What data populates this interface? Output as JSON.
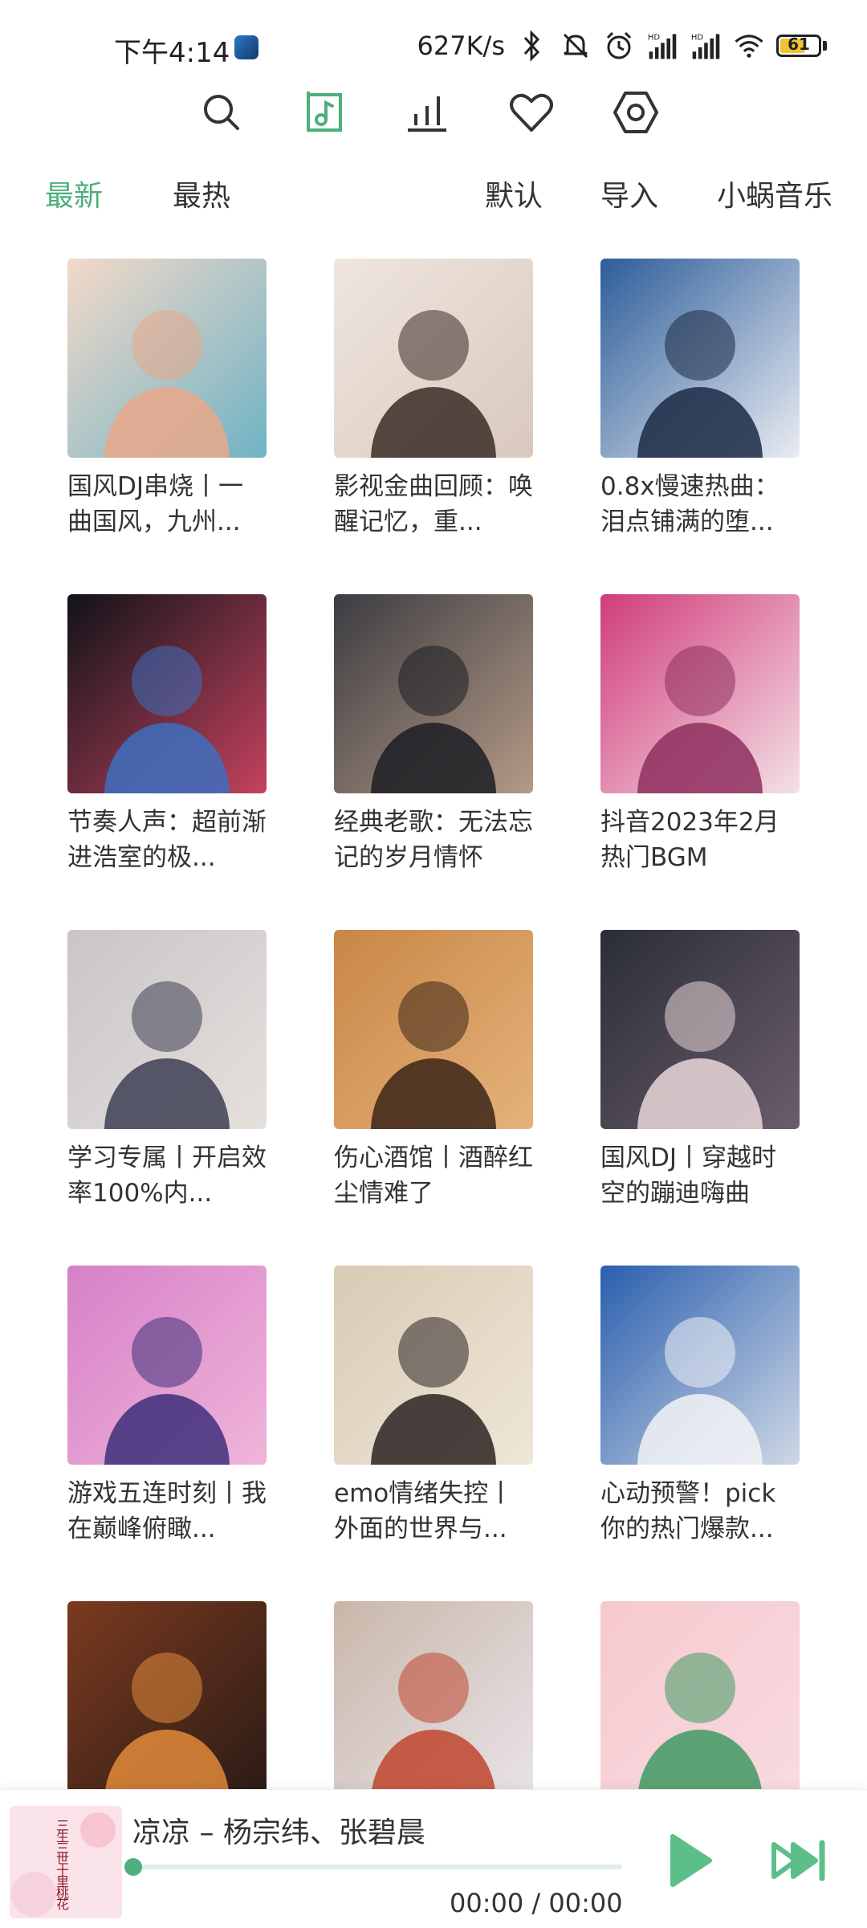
{
  "status_bar": {
    "time": "下午4:14",
    "speed": "627K/s",
    "battery": "61",
    "icons": [
      "bluetooth-icon",
      "mute-icon",
      "alarm-icon",
      "signal-hd-icon",
      "signal-hd-icon",
      "wifi-icon",
      "battery-icon"
    ]
  },
  "nav_icons": [
    "search-icon",
    "music-file-icon",
    "chart-icon",
    "heart-icon",
    "settings-hex-icon"
  ],
  "accent_color": "#4caf7d",
  "tabs": {
    "latest": "最新",
    "hottest": "最热",
    "default": "默认",
    "import": "导入",
    "source": "小蜗音乐"
  },
  "playlists": [
    {
      "title": "国风DJ串烧丨一曲国风，九州...",
      "colors": [
        "#f3d9c9",
        "#e9a889",
        "#6fb3c4"
      ]
    },
    {
      "title": "影视金曲回顾：唤醒记忆，重...",
      "colors": [
        "#efe6df",
        "#3b2b26",
        "#d9c8bd"
      ]
    },
    {
      "title": "0.8x慢速热曲：泪点铺满的堕...",
      "colors": [
        "#2d5d9a",
        "#1b2a44",
        "#e9ecf2"
      ]
    },
    {
      "title": "节奏人声：超前渐进浩室的极...",
      "colors": [
        "#101318",
        "#3d6fbf",
        "#c4425f"
      ]
    },
    {
      "title": "经典老歌：无法忘记的岁月情怀",
      "colors": [
        "#3c3c42",
        "#1c1d23",
        "#b49a86"
      ]
    },
    {
      "title": "抖音2023年2月热门BGM",
      "colors": [
        "#d03c7a",
        "#8e2f5e",
        "#f4e1e7"
      ]
    },
    {
      "title": "学习专属丨开启效率100%内...",
      "colors": [
        "#c9c5c8",
        "#3c3e52",
        "#e6e0dc"
      ]
    },
    {
      "title": "伤心酒馆丨酒醉红尘情难了",
      "colors": [
        "#c88746",
        "#3b2418",
        "#e5b27b"
      ]
    },
    {
      "title": "国风DJ丨穿越时空的蹦迪嗨曲",
      "colors": [
        "#2a2e36",
        "#e9d7d8",
        "#6b5c6c"
      ]
    },
    {
      "title": "游戏五连时刻丨我在巅峰俯瞰...",
      "colors": [
        "#d681c8",
        "#3e2f7a",
        "#f0b4d9"
      ]
    },
    {
      "title": "emo情绪失控丨外面的世界与...",
      "colors": [
        "#d9cbb4",
        "#2a2322",
        "#efe6d8"
      ]
    },
    {
      "title": "心动预警！pick你的热门爆款...",
      "colors": [
        "#2b5fae",
        "#f2f3f6",
        "#cfd8e6"
      ]
    },
    {
      "title": "",
      "colors": [
        "#7b3a1f",
        "#e28a3b",
        "#2a1b16"
      ]
    },
    {
      "title": "",
      "colors": [
        "#c9b7a8",
        "#c0452d",
        "#e9e3ea"
      ]
    },
    {
      "title": "",
      "colors": [
        "#f6c9cf",
        "#3f9a63",
        "#f8dbe0"
      ]
    }
  ],
  "player": {
    "title": "凉凉 – 杨宗纬、张碧晨",
    "time": "00:00 / 00:00",
    "progress": 0,
    "art_text": "三生三世十里桃花"
  }
}
